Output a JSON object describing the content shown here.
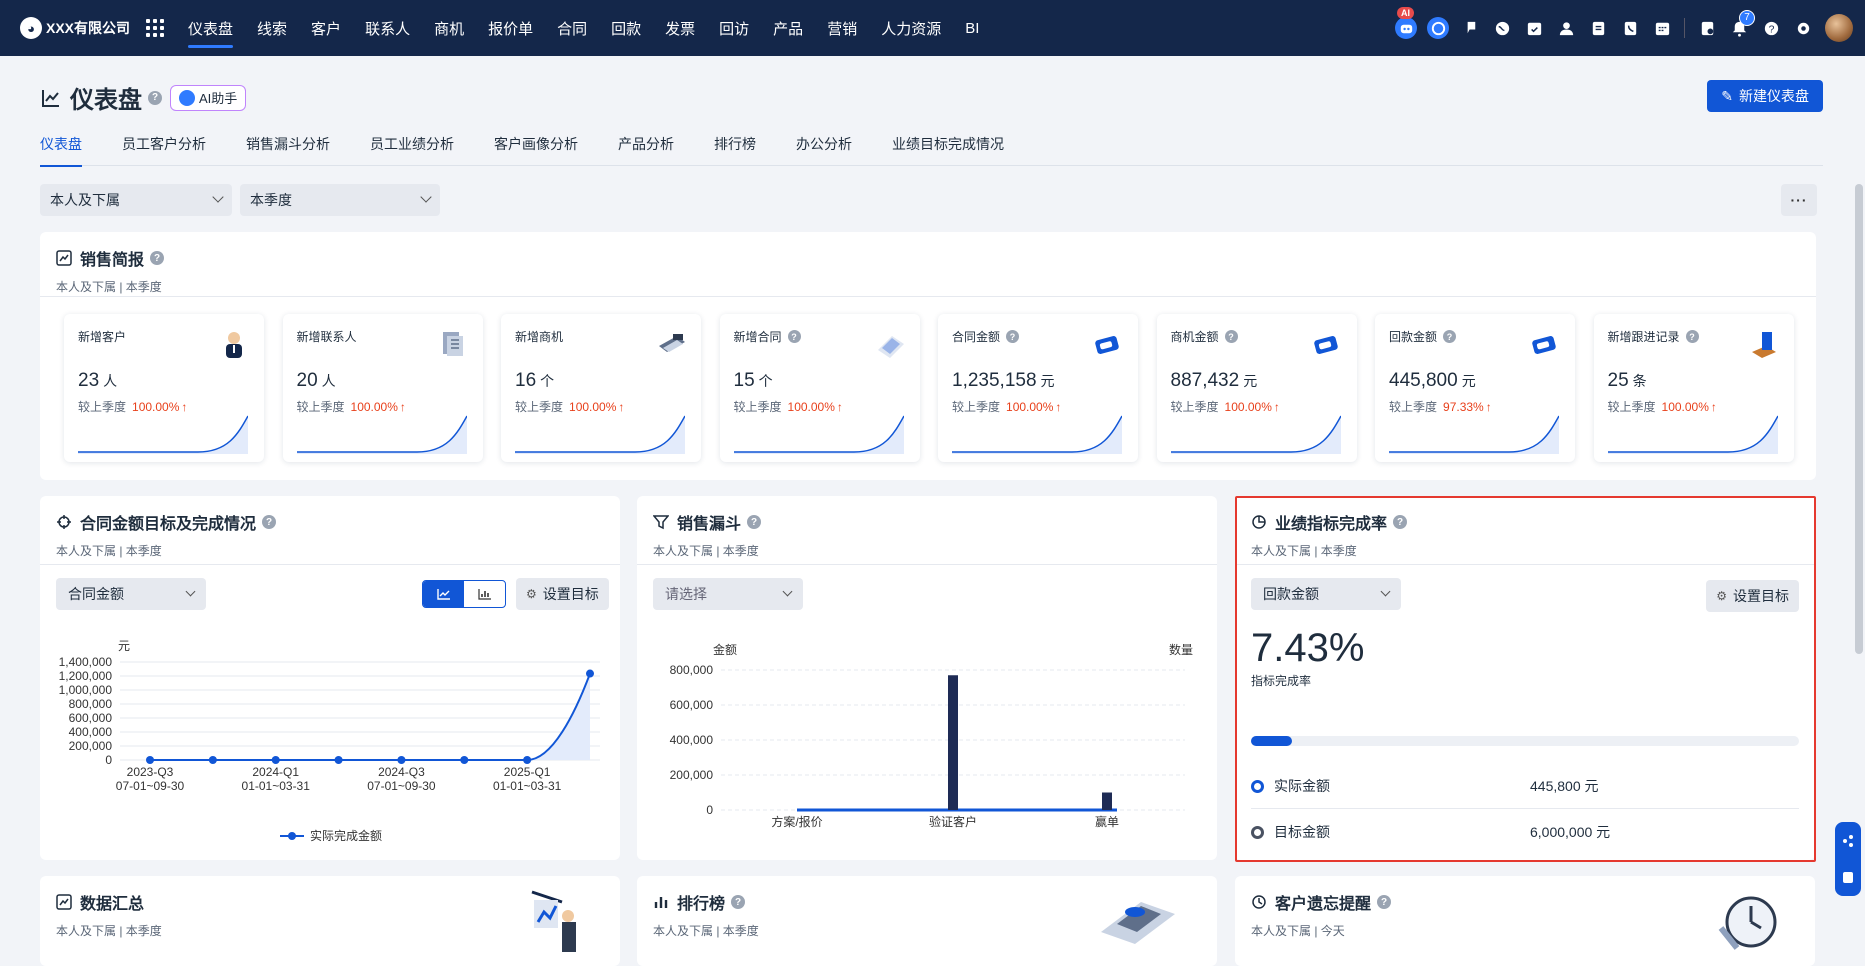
{
  "topbar": {
    "company": "XXX有限公司",
    "nav": [
      "仪表盘",
      "线索",
      "客户",
      "联系人",
      "商机",
      "报价单",
      "合同",
      "回款",
      "发票",
      "回访",
      "产品",
      "营销",
      "人力资源",
      "BI"
    ],
    "ai_badge": "AI",
    "notification_count": "7"
  },
  "header": {
    "title": "仪表盘",
    "ai_helper": "AI助手",
    "new_button": "新建仪表盘"
  },
  "tabs": [
    "仪表盘",
    "员工客户分析",
    "销售漏斗分析",
    "员工业绩分析",
    "客户画像分析",
    "产品分析",
    "排行榜",
    "办公分析",
    "业绩目标完成情况"
  ],
  "filters": {
    "scope": "本人及下属",
    "period": "本季度"
  },
  "sales_brief": {
    "title": "销售简报",
    "sub": "本人及下属 | 本季度",
    "compare_label": "较上季度",
    "stats": [
      {
        "label": "新增客户",
        "value": "23",
        "unit": "人",
        "pct": "100.00%"
      },
      {
        "label": "新增联系人",
        "value": "20",
        "unit": "人",
        "pct": "100.00%"
      },
      {
        "label": "新增商机",
        "value": "16",
        "unit": "个",
        "pct": "100.00%"
      },
      {
        "label": "新增合同",
        "value": "15",
        "unit": "个",
        "pct": "100.00%"
      },
      {
        "label": "合同金额",
        "value": "1,235,158",
        "unit": "元",
        "pct": "100.00%"
      },
      {
        "label": "商机金额",
        "value": "887,432",
        "unit": "元",
        "pct": "100.00%"
      },
      {
        "label": "回款金额",
        "value": "445,800",
        "unit": "元",
        "pct": "97.33%"
      },
      {
        "label": "新增跟进记录",
        "value": "25",
        "unit": "条",
        "pct": "100.00%"
      }
    ]
  },
  "contract_target": {
    "title": "合同金额目标及完成情况",
    "sub": "本人及下属 | 本季度",
    "select": "合同金额",
    "goal_btn": "设置目标",
    "unit": "元",
    "legend": "实际完成金额"
  },
  "funnel": {
    "title": "销售漏斗",
    "sub": "本人及下属 | 本季度",
    "select_placeholder": "请选择",
    "left_axis": "金额",
    "right_axis": "数量"
  },
  "kpi": {
    "title": "业绩指标完成率",
    "sub": "本人及下属 | 本季度",
    "select": "回款金额",
    "goal_btn": "设置目标",
    "rate": "7.43%",
    "rate_label": "指标完成率",
    "progress": 0.0743,
    "actual_label": "实际金额",
    "actual_value": "445,800 元",
    "target_label": "目标金额",
    "target_value": "6,000,000 元"
  },
  "bottom_cards": [
    {
      "title": "数据汇总",
      "sub": "本人及下属 | 本季度"
    },
    {
      "title": "排行榜",
      "sub": "本人及下属 | 本季度"
    },
    {
      "title": "客户遗忘提醒",
      "sub": "本人及下属 | 今天"
    }
  ],
  "chart_data": [
    {
      "type": "line",
      "ylabel": "元",
      "ylim": [
        0,
        1400000
      ],
      "yticks": [
        "1,400,000",
        "1,200,000",
        "1,000,000",
        "800,000",
        "600,000",
        "400,000",
        "200,000",
        "0"
      ],
      "xticks": [
        [
          "2023-Q3",
          "07-01~09-30"
        ],
        [
          "2024-Q1",
          "01-01~03-31"
        ],
        [
          "2024-Q3",
          "07-01~09-30"
        ],
        [
          "2025-Q1",
          "01-01~03-31"
        ]
      ],
      "series": [
        {
          "name": "实际完成金额",
          "values": [
            0,
            0,
            0,
            0,
            0,
            0,
            0,
            1235158
          ]
        }
      ]
    },
    {
      "type": "bar",
      "categories": [
        "方案/报价",
        "验证客户",
        "赢单"
      ],
      "ylim": [
        0,
        800000
      ],
      "yticks": [
        "800,000",
        "600,000",
        "400,000",
        "200,000",
        "0"
      ],
      "values": [
        0,
        770000,
        100000
      ]
    }
  ]
}
